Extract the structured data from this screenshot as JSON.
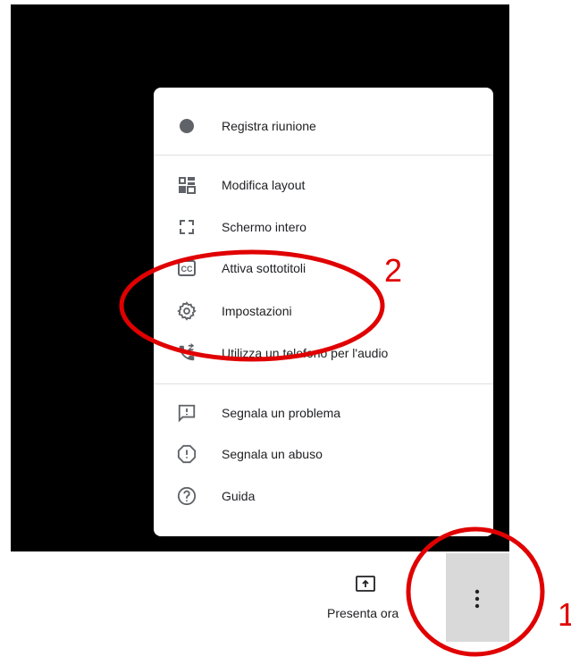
{
  "menu": {
    "items": [
      {
        "label": "Registra riunione",
        "icon": "record-dot-icon"
      },
      {
        "label": "Modifica layout",
        "icon": "layout-icon"
      },
      {
        "label": "Schermo intero",
        "icon": "fullscreen-icon"
      },
      {
        "label": "Attiva sottotitoli",
        "icon": "closed-captions-icon"
      },
      {
        "label": "Impostazioni",
        "icon": "gear-icon"
      },
      {
        "label": "Utilizza un telefono per l'audio",
        "icon": "phone-forward-icon"
      },
      {
        "label": "Segnala un problema",
        "icon": "feedback-icon"
      },
      {
        "label": "Segnala un abuso",
        "icon": "report-icon"
      },
      {
        "label": "Guida",
        "icon": "help-icon"
      }
    ]
  },
  "toolbar": {
    "present_label": "Presenta ora",
    "present_icon": "present-screen-icon",
    "more_icon": "more-vert-icon"
  },
  "annotations": {
    "label_1": "1",
    "label_2": "2",
    "color": "#e00000"
  },
  "colors": {
    "video_background": "#000000",
    "menu_background": "#ffffff",
    "icon": "#5f6368",
    "text": "#202124",
    "more_button_background": "#d9d9d9"
  }
}
